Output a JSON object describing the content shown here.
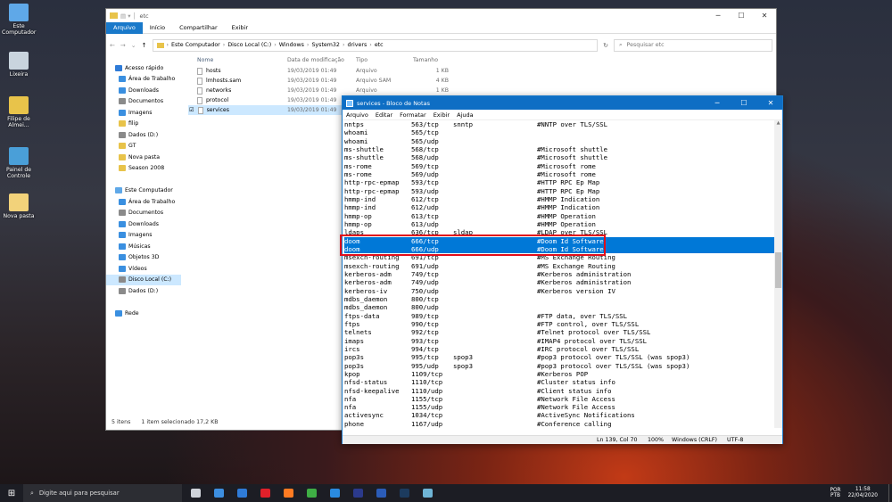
{
  "desktop": {
    "icons": [
      {
        "label": "Este\nComputador",
        "color": "#5fa8e8"
      },
      {
        "label": "Lixeira",
        "color": "#c9d4de"
      },
      {
        "label": "Filipe de\nAlmei...",
        "color": "#e8c34a"
      },
      {
        "label": "Painel de\nControle",
        "color": "#4a9fd8"
      },
      {
        "label": "Nova pasta",
        "color": "#f2d27a"
      }
    ]
  },
  "explorer": {
    "title": "etc",
    "ribbon_tabs": [
      "Arquivo",
      "Início",
      "Compartilhar",
      "Exibir"
    ],
    "breadcrumb": [
      "Este Computador",
      "Disco Local (C:)",
      "Windows",
      "System32",
      "drivers",
      "etc"
    ],
    "search_placeholder": "Pesquisar etc",
    "nav": [
      {
        "label": "Acesso rápido",
        "level": 0,
        "color": "#2f7bd7"
      },
      {
        "label": "Área de Trabalho",
        "level": 1,
        "color": "#3a8fe0"
      },
      {
        "label": "Downloads",
        "level": 1,
        "color": "#3a8fe0"
      },
      {
        "label": "Documentos",
        "level": 1,
        "color": "#8a8a8a"
      },
      {
        "label": "Imagens",
        "level": 1,
        "color": "#3a8fe0"
      },
      {
        "label": "filip",
        "level": 1,
        "color": "#e8c34a"
      },
      {
        "label": "Dados (D:)",
        "level": 1,
        "color": "#8a8a8a"
      },
      {
        "label": "GT",
        "level": 1,
        "color": "#e8c34a"
      },
      {
        "label": "Nova pasta",
        "level": 1,
        "color": "#e8c34a"
      },
      {
        "label": "Season 2008",
        "level": 1,
        "color": "#e8c34a"
      },
      {
        "label": "",
        "level": 1,
        "color": ""
      },
      {
        "label": "Este Computador",
        "level": 0,
        "color": "#5fa8e8"
      },
      {
        "label": "Área de Trabalho",
        "level": 1,
        "color": "#3a8fe0"
      },
      {
        "label": "Documentos",
        "level": 1,
        "color": "#8a8a8a"
      },
      {
        "label": "Downloads",
        "level": 1,
        "color": "#3a8fe0"
      },
      {
        "label": "Imagens",
        "level": 1,
        "color": "#3a8fe0"
      },
      {
        "label": "Músicas",
        "level": 1,
        "color": "#3a8fe0"
      },
      {
        "label": "Objetos 3D",
        "level": 1,
        "color": "#3a8fe0"
      },
      {
        "label": "Vídeos",
        "level": 1,
        "color": "#3a8fe0"
      },
      {
        "label": "Disco Local (C:)",
        "level": 1,
        "color": "#8a8a8a",
        "selected": true
      },
      {
        "label": "Dados (D:)",
        "level": 1,
        "color": "#8a8a8a"
      },
      {
        "label": "",
        "level": 1,
        "color": ""
      },
      {
        "label": "Rede",
        "level": 0,
        "color": "#3a8fe0"
      }
    ],
    "columns": [
      "Nome",
      "Data de modificação",
      "Tipo",
      "Tamanho"
    ],
    "files": [
      {
        "name": "hosts",
        "date": "19/03/2019 01:49",
        "type": "Arquivo",
        "size": "1 KB"
      },
      {
        "name": "lmhosts.sam",
        "date": "19/03/2019 01:49",
        "type": "Arquivo SAM",
        "size": "4 KB"
      },
      {
        "name": "networks",
        "date": "19/03/2019 01:49",
        "type": "Arquivo",
        "size": "1 KB"
      },
      {
        "name": "protocol",
        "date": "19/03/2019 01:49",
        "type": "Arquivo",
        "size": "2 KB"
      },
      {
        "name": "services",
        "date": "19/03/2019 01:49",
        "type": "",
        "size": "",
        "selected": true
      }
    ],
    "status": {
      "count": "5 itens",
      "selection": "1 item selecionado 17,2 KB"
    }
  },
  "notepad": {
    "title": "services - Bloco de Notas",
    "menu": [
      "Arquivo",
      "Editar",
      "Formatar",
      "Exibir",
      "Ajuda"
    ],
    "lines": [
      [
        "nntps",
        "563/tcp",
        "snntp",
        "#NNTP over TLS/SSL"
      ],
      [
        "whoami",
        "565/tcp",
        "",
        ""
      ],
      [
        "whoami",
        "565/udp",
        "",
        ""
      ],
      [
        "ms-shuttle",
        "568/tcp",
        "",
        "#Microsoft shuttle"
      ],
      [
        "ms-shuttle",
        "568/udp",
        "",
        "#Microsoft shuttle"
      ],
      [
        "ms-rome",
        "569/tcp",
        "",
        "#Microsoft rome"
      ],
      [
        "ms-rome",
        "569/udp",
        "",
        "#Microsoft rome"
      ],
      [
        "http-rpc-epmap",
        "593/tcp",
        "",
        "#HTTP RPC Ep Map"
      ],
      [
        "http-rpc-epmap",
        "593/udp",
        "",
        "#HTTP RPC Ep Map"
      ],
      [
        "hmmp-ind",
        "612/tcp",
        "",
        "#HMMP Indication"
      ],
      [
        "hmmp-ind",
        "612/udp",
        "",
        "#HMMP Indication"
      ],
      [
        "hmmp-op",
        "613/tcp",
        "",
        "#HMMP Operation"
      ],
      [
        "hmmp-op",
        "613/udp",
        "",
        "#HMMP Operation"
      ],
      [
        "ldaps",
        "636/tcp",
        "sldap",
        "#LDAP over TLS/SSL"
      ],
      [
        "doom",
        "666/tcp",
        "",
        "#Doom Id Software"
      ],
      [
        "doom",
        "666/udp",
        "",
        "#Doom Id Software"
      ],
      [
        "msexch-routing",
        "691/tcp",
        "",
        "#MS Exchange Routing"
      ],
      [
        "msexch-routing",
        "691/udp",
        "",
        "#MS Exchange Routing"
      ],
      [
        "kerberos-adm",
        "749/tcp",
        "",
        "#Kerberos administration"
      ],
      [
        "kerberos-adm",
        "749/udp",
        "",
        "#Kerberos administration"
      ],
      [
        "kerberos-iv",
        "750/udp",
        "",
        "#Kerberos version IV"
      ],
      [
        "mdbs_daemon",
        "800/tcp",
        "",
        ""
      ],
      [
        "mdbs_daemon",
        "800/udp",
        "",
        ""
      ],
      [
        "ftps-data",
        "989/tcp",
        "",
        "#FTP data, over TLS/SSL"
      ],
      [
        "ftps",
        "990/tcp",
        "",
        "#FTP control, over TLS/SSL"
      ],
      [
        "telnets",
        "992/tcp",
        "",
        "#Telnet protocol over TLS/SSL"
      ],
      [
        "imaps",
        "993/tcp",
        "",
        "#IMAP4 protocol over TLS/SSL"
      ],
      [
        "ircs",
        "994/tcp",
        "",
        "#IRC protocol over TLS/SSL"
      ],
      [
        "pop3s",
        "995/tcp",
        "spop3",
        "#pop3 protocol over TLS/SSL (was spop3)"
      ],
      [
        "pop3s",
        "995/udp",
        "spop3",
        "#pop3 protocol over TLS/SSL (was spop3)"
      ],
      [
        "kpop",
        "1109/tcp",
        "",
        "#Kerberos POP"
      ],
      [
        "nfsd-status",
        "1110/tcp",
        "",
        "#Cluster status info"
      ],
      [
        "nfsd-keepalive",
        "1110/udp",
        "",
        "#Client status info"
      ],
      [
        "nfa",
        "1155/tcp",
        "",
        "#Network File Access"
      ],
      [
        "nfa",
        "1155/udp",
        "",
        "#Network File Access"
      ],
      [
        "activesync",
        "1034/tcp",
        "",
        "#ActiveSync Notifications"
      ],
      [
        "phone",
        "1167/udp",
        "",
        "#Conference calling"
      ]
    ],
    "highlighted_lines": [
      14,
      15
    ],
    "status": {
      "position": "Ln 139, Col 70",
      "zoom": "100%",
      "eol": "Windows (CRLF)",
      "encoding": "UTF-8"
    }
  },
  "taskbar": {
    "search_placeholder": "Digite aqui para pesquisar",
    "apps": [
      {
        "name": "task-view",
        "color": "#cfd3da"
      },
      {
        "name": "app-2",
        "color": "#3d8fe0"
      },
      {
        "name": "mail",
        "color": "#2f7bd7"
      },
      {
        "name": "opera",
        "color": "#e0202a"
      },
      {
        "name": "firefox",
        "color": "#ff7b22"
      },
      {
        "name": "app-6",
        "color": "#3fae45"
      },
      {
        "name": "vscode",
        "color": "#2a8be0"
      },
      {
        "name": "photoshop",
        "color": "#2b3a8c"
      },
      {
        "name": "word",
        "color": "#2b5cb8"
      },
      {
        "name": "steam",
        "color": "#1c3b5e"
      },
      {
        "name": "app-11",
        "color": "#6fb5d6"
      }
    ],
    "lang": "POR\nPTB",
    "time": "11:58",
    "date": "22/04/2020"
  }
}
